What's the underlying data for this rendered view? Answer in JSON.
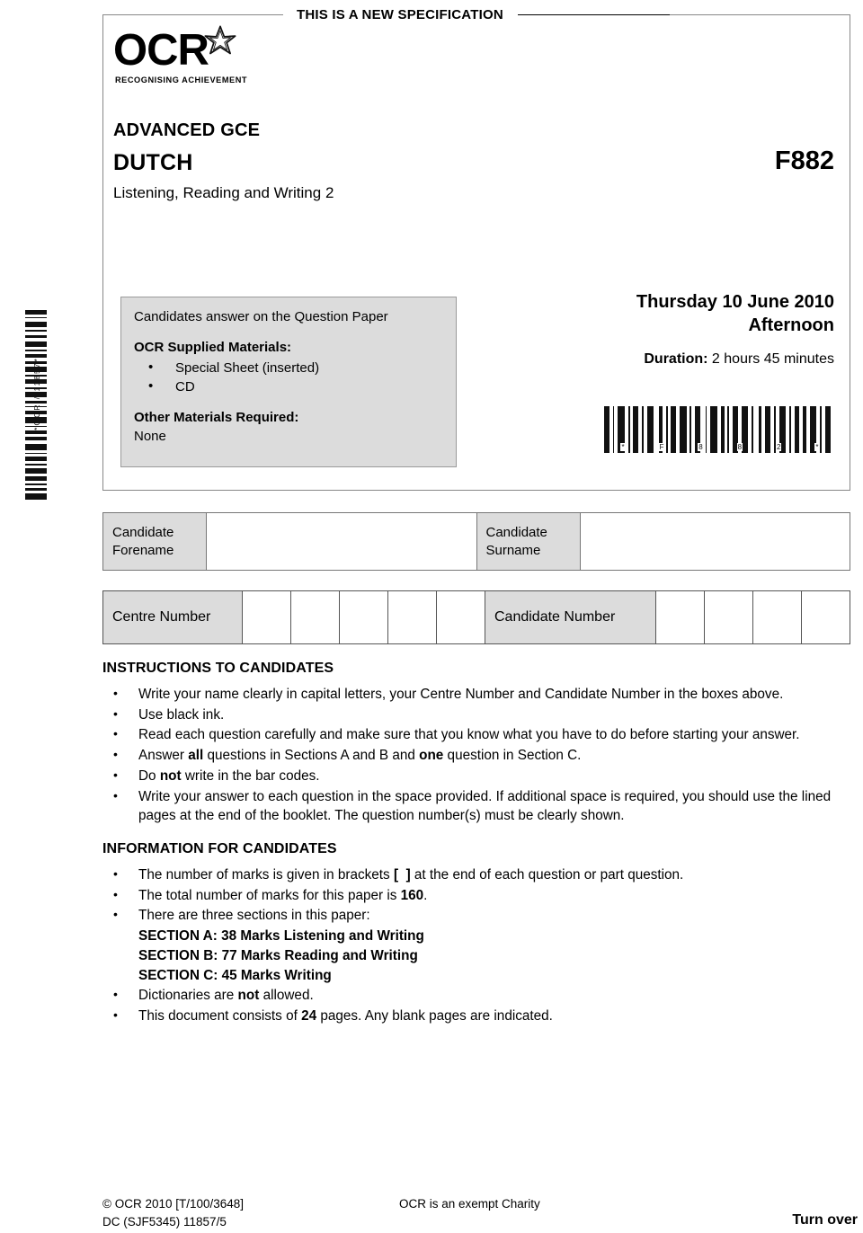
{
  "banner": {
    "text": "THIS IS A NEW SPECIFICATION"
  },
  "logo": {
    "word": "OCR",
    "tagline": "RECOGNISING ACHIEVEMENT",
    "icon": "star-icon"
  },
  "title": {
    "qualification": "ADVANCED GCE",
    "subject": "DUTCH",
    "paper": "Listening, Reading and Writing 2",
    "code": "F882"
  },
  "materials": {
    "lead": "Candidates answer on the Question Paper",
    "supplied_heading": "OCR Supplied Materials:",
    "supplied_items": [
      "Special Sheet (inserted)",
      "CD"
    ],
    "other_heading": "Other Materials Required:",
    "other_value": "None"
  },
  "exam_datetime": {
    "date": "Thursday 10 June 2010",
    "session": "Afternoon",
    "duration_label": "Duration:",
    "duration_value": "2 hours 45 minutes"
  },
  "barcodes": {
    "horizontal_text": "*F882*",
    "horizontal_chars": [
      "*",
      "F",
      "8",
      "8",
      "2",
      "*"
    ],
    "vertical_text": "*OCR / 11857*"
  },
  "candidate_fields": {
    "forename_label": "Candidate\nForename",
    "forename_line1": "Candidate",
    "forename_line2": "Forename",
    "surname_line1": "Candidate",
    "surname_line2": "Surname",
    "centre_number_label": "Centre Number",
    "centre_number_boxes": 5,
    "candidate_number_label": "Candidate Number",
    "candidate_number_boxes": 4
  },
  "instructions": {
    "heading": "INSTRUCTIONS TO CANDIDATES",
    "items": [
      "Write your name clearly in capital letters, your Centre Number and Candidate Number in the boxes above.",
      "Use black ink.",
      "Read each question carefully and make sure that you know what you have to do before starting your answer.",
      "Answer all questions in Sections A and B and one question in Section C.",
      "Do not write in the bar codes.",
      "Write your answer to each question in the space provided. If additional space is required, you should use the lined pages at the end of the booklet. The question number(s) must be clearly shown."
    ]
  },
  "information": {
    "heading": "INFORMATION FOR CANDIDATES",
    "items": [
      "The number of marks is given in brackets [  ] at the end of each question or part question.",
      "The total number of marks for this paper is 160.",
      "There are three sections in this paper:",
      "Dictionaries are not allowed.",
      "This document consists of 24 pages. Any blank pages are indicated."
    ],
    "sections": [
      "SECTION A: 38 Marks  Listening and Writing",
      "SECTION B: 77 Marks  Reading and Writing",
      "SECTION C: 45 Marks  Writing"
    ]
  },
  "footer": {
    "copyright": "© OCR 2010  [T/100/3648]",
    "doc_code": "DC (SJF5345) 11857/5",
    "charity": "OCR is an exempt Charity",
    "turn_over": "Turn over"
  }
}
